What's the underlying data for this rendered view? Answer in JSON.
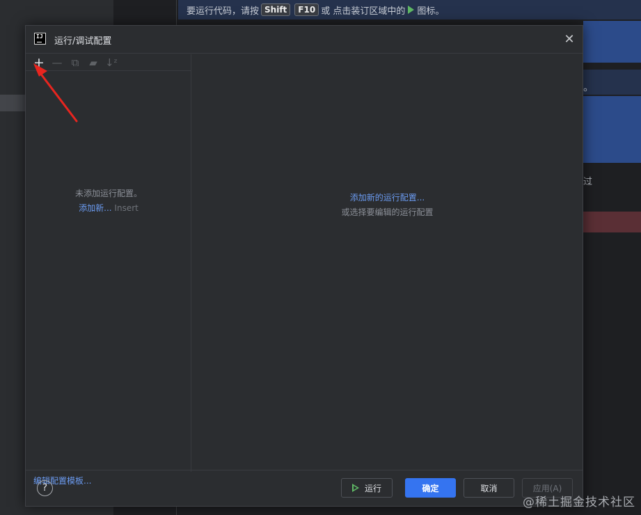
{
  "background": {
    "banner": {
      "prefix": "要运行代码，请按",
      "key1": "Shift",
      "key2": "F10",
      "middle": "或 点击装订区域中的",
      "suffix": "图标。"
    },
    "fragment_period": "。",
    "fragment_guo": "过"
  },
  "dialog": {
    "title": "运行/调试配置",
    "logo_text": "IJ",
    "close_glyph": "✕",
    "toolbar": {
      "add_glyph": "+",
      "remove_glyph": "—",
      "copy_glyph": "⧉",
      "folder_glyph": "▰",
      "sort_glyph": "↓ᶻ"
    },
    "left": {
      "empty_text": "未添加运行配置。",
      "add_new_link": "添加新...",
      "add_new_shortcut": "Insert",
      "edit_templates_link": "编辑配置模板..."
    },
    "right": {
      "add_config_link": "添加新的运行配置...",
      "or_select_text": "或选择要编辑的运行配置"
    },
    "footer": {
      "help_glyph": "?",
      "run_label": "运行",
      "ok_label": "确定",
      "cancel_label": "取消",
      "apply_label": "应用(A)"
    }
  },
  "watermark": "@稀土掘金技术社区",
  "colors": {
    "accent": "#3574f0",
    "link": "#6b9bf1",
    "run_icon": "#5fb865",
    "annotation_arrow": "#e8251f"
  }
}
